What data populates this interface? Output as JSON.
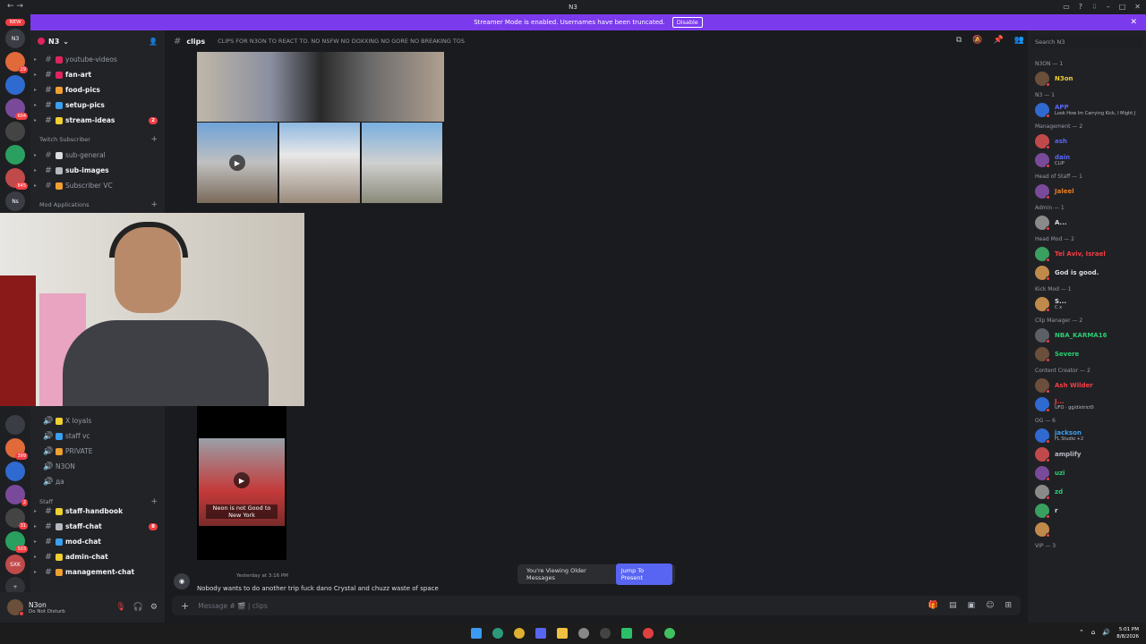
{
  "window": {
    "title": "N3"
  },
  "banner": {
    "text": "Streamer Mode is enabled. Usernames have been truncated.",
    "button": "Disable"
  },
  "guilds": {
    "new_label": "NEW",
    "items": [
      {
        "label": "N3",
        "badge": ""
      },
      {
        "label": "",
        "badge": "29"
      },
      {
        "label": "",
        "badge": ""
      },
      {
        "label": "",
        "badge": "604"
      },
      {
        "label": "",
        "badge": ""
      },
      {
        "label": "",
        "badge": ""
      },
      {
        "label": "",
        "badge": "845"
      },
      {
        "label": "Ns",
        "badge": ""
      },
      {
        "label": "",
        "badge": ""
      }
    ],
    "lower_items": [
      {
        "label": "",
        "badge": ""
      },
      {
        "label": "",
        "badge": "399"
      },
      {
        "label": "",
        "badge": ""
      },
      {
        "label": "",
        "badge": "2"
      },
      {
        "label": "",
        "badge": "31"
      },
      {
        "label": "",
        "badge": "503"
      },
      {
        "label": "SXK",
        "badge": ""
      }
    ]
  },
  "server": {
    "name": "N3"
  },
  "channels_top": [
    {
      "name": "youtube-videos",
      "bright": false,
      "color": "#e0245e",
      "badge": ""
    },
    {
      "name": "fan-art",
      "bright": true,
      "color": "#e0245e",
      "badge": ""
    },
    {
      "name": "food-pics",
      "bright": true,
      "color": "#f0a030",
      "badge": ""
    },
    {
      "name": "setup-pics",
      "bright": true,
      "color": "#3aa0f0",
      "badge": ""
    },
    {
      "name": "stream-ideas",
      "bright": true,
      "color": "#f0d030",
      "badge": "2"
    }
  ],
  "category_sub": "Twitch Subscriber",
  "channels_sub": [
    {
      "name": "sub-general",
      "bright": false,
      "color": "#dbdee1",
      "badge": ""
    },
    {
      "name": "sub-images",
      "bright": true,
      "color": "#b5bac1",
      "badge": ""
    },
    {
      "name": "Subscriber VC",
      "bright": false,
      "color": "#f0a030",
      "badge": ""
    }
  ],
  "category_mod": "Mod Applications",
  "channels_voice": [
    {
      "name": "X loyals",
      "bright": false,
      "color": "#f0d030",
      "badge": ""
    },
    {
      "name": "staff vc",
      "bright": false,
      "color": "#3aa0f0",
      "badge": ""
    },
    {
      "name": "PRIVATE",
      "bright": false,
      "color": "#f0a030",
      "badge": ""
    },
    {
      "name": "N3ON",
      "bright": false,
      "color": "",
      "badge": ""
    },
    {
      "name": "да",
      "bright": false,
      "color": "",
      "badge": ""
    }
  ],
  "category_staff": "Staff",
  "channels_staff": [
    {
      "name": "staff-handbook",
      "bright": true,
      "color": "#f0d030",
      "badge": ""
    },
    {
      "name": "staff-chat",
      "bright": true,
      "color": "#b5bac1",
      "badge": "8"
    },
    {
      "name": "mod-chat",
      "bright": true,
      "color": "#3aa0f0",
      "badge": ""
    },
    {
      "name": "admin-chat",
      "bright": true,
      "color": "#f0d030",
      "badge": ""
    },
    {
      "name": "management-chat",
      "bright": true,
      "color": "#f0a030",
      "badge": ""
    }
  ],
  "user": {
    "name": "N3on",
    "status": "Do Not Disturb"
  },
  "channel": {
    "name": "clips",
    "topic": "CLIPS FOR N3ON TO REACT TO. NO NSFW NO DOXXING NO GORE NO BREAKING TOS"
  },
  "video_caption": "Neon is not Good to New York",
  "message": {
    "timestamp": "Yesterday at 3:16 PM",
    "text": "Nobody wants to do another  trip fuck dano Crystal  and chuzz waste of space"
  },
  "older_notice": {
    "text": "You're Viewing Older Messages",
    "button": "Jump To Present"
  },
  "composer": {
    "placeholder": "Message # 🎬 | clips"
  },
  "members": {
    "search_placeholder": "Search N3",
    "groups": [
      {
        "title": "N3ON — 1",
        "members": [
          {
            "name": "N3on",
            "color": "#f0d030",
            "sub": ""
          }
        ]
      },
      {
        "title": "N3 — 1",
        "members": [
          {
            "name": "APP",
            "color": "#5865f2",
            "sub": "Look How Im Carrying Kick, I Might J"
          }
        ]
      },
      {
        "title": "Management — 2",
        "members": [
          {
            "name": "ash",
            "color": "#5865f2",
            "sub": ""
          },
          {
            "name": "dain",
            "color": "#5865f2",
            "sub": "CLIP"
          }
        ]
      },
      {
        "title": "Head of Staff — 1",
        "members": [
          {
            "name": "Jaleel",
            "color": "#e67e22",
            "sub": ""
          }
        ]
      },
      {
        "title": "Admin — 1",
        "members": [
          {
            "name": "A...",
            "color": "#dbdee1",
            "sub": ""
          }
        ]
      },
      {
        "title": "Head Mod — 2",
        "members": [
          {
            "name": "Tel Aviv, Israel",
            "color": "#f23f43",
            "sub": ""
          },
          {
            "name": "God is good.",
            "color": "#dbdee1",
            "sub": ""
          }
        ]
      },
      {
        "title": "Kick Mod — 1",
        "members": [
          {
            "name": "S...",
            "color": "#dbdee1",
            "sub": "C x"
          }
        ]
      },
      {
        "title": "Clip Manager — 2",
        "members": [
          {
            "name": "NBA_KARMA16",
            "color": "#2ecc71",
            "sub": ""
          },
          {
            "name": "Severe",
            "color": "#2ecc71",
            "sub": ""
          }
        ]
      },
      {
        "title": "Content Creator — 2",
        "members": [
          {
            "name": "Ash Wilder",
            "color": "#f23f43",
            "sub": ""
          },
          {
            "name": "J...",
            "color": "#f23f43",
            "sub": "UFO · gg/district0"
          }
        ]
      },
      {
        "title": "OG — 6",
        "members": [
          {
            "name": "jackson",
            "color": "#3aa0f0",
            "sub": "FL Studio +2"
          },
          {
            "name": "amplify",
            "color": "#b5bac1",
            "sub": ""
          },
          {
            "name": "uzi",
            "color": "#2ecc71",
            "sub": ""
          },
          {
            "name": "zd",
            "color": "#2ecc71",
            "sub": ""
          },
          {
            "name": "r",
            "color": "#dbdee1",
            "sub": ""
          },
          {
            "name": "",
            "color": "#dbdee1",
            "sub": ""
          }
        ]
      },
      {
        "title": "VIP — 3",
        "members": []
      }
    ]
  },
  "clock": {
    "time": "5:01 PM",
    "date": "8/8/2026"
  }
}
